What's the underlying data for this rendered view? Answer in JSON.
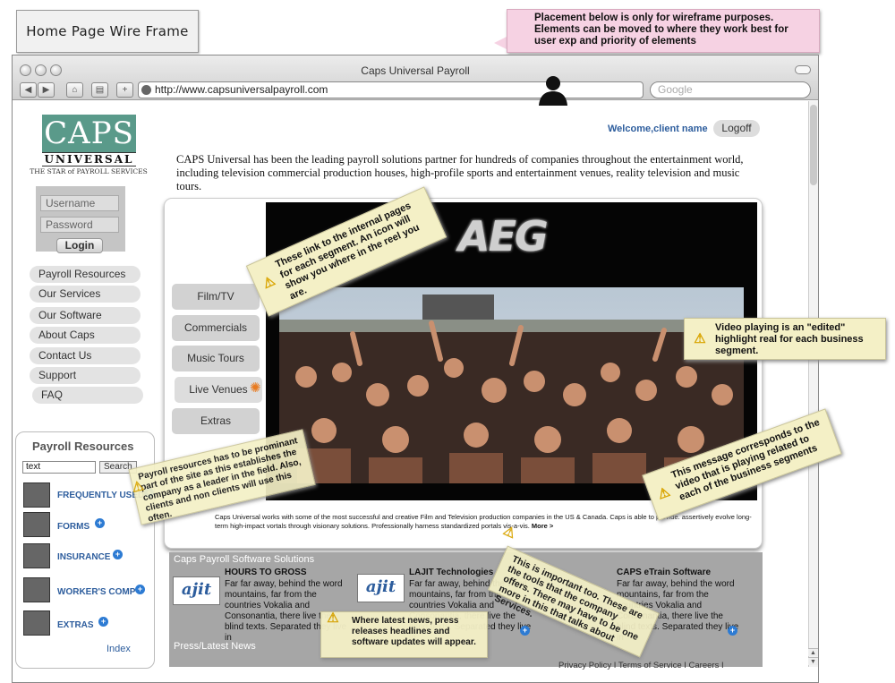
{
  "wireframe_title": "Home Page Wire Frame",
  "notes": {
    "placement": "Placement below is only for wireframe purposes. Elements can be moved to where they work best for user exp and priority of elements",
    "segments": "These link to the internal pages for each segment. An icon will show you where in the reel you are.",
    "video": "Video playing is an \"edited\" highlight real for each business segment.",
    "message": "This message corresponds to the video that is playing related to each of the business segments",
    "payroll": "Payroll resources has to be prominant part of the site as this establishes the company as a leader in the field. Also, clients and non clients will use this often.",
    "tools": "This is important too. These are the tools that the company offers. There may have to be one more in this that talks about Services.",
    "press": "Where latest news, press releases headlines and software updates will appear."
  },
  "browser": {
    "title": "Caps Universal Payroll",
    "url": "http://www.capsuniversalpayroll.com",
    "search_placeholder": "Google"
  },
  "logo": {
    "main": "CAPS",
    "band": "UNIVERSAL",
    "tagline": "THE STAR of PAYROLL SERVICES"
  },
  "login": {
    "username_placeholder": "Username",
    "password_placeholder": "Password",
    "button": "Login"
  },
  "sidebar": {
    "items": [
      {
        "label": "Payroll Resources"
      },
      {
        "label": "Our Services"
      },
      {
        "label": "Our Software"
      },
      {
        "label": "About Caps"
      },
      {
        "label": "Contact Us"
      },
      {
        "label": "Support"
      },
      {
        "label": "FAQ"
      }
    ]
  },
  "header": {
    "welcome": "Welcome,client name",
    "logoff": "Logoff"
  },
  "intro": "CAPS Universal has been the leading payroll solutions partner for hundreds of companies throughout the entertainment world, including television commercial production houses, high-profile sports and entertainment venues, reality television and music tours.",
  "video": {
    "brand": "AEG",
    "segments": [
      "Film/TV",
      "Commercials",
      "Music Tours",
      "Live Venues",
      "Extras"
    ],
    "caption": "Caps Universal works with some of the most successful and creative Film and Television production companies in the US & Canada.  Caps is able to provide. assertively evolve long-term high-impact vortals through visionary solutions. Professionally harness standardized portals vis-a-vis.",
    "more": "More >"
  },
  "software": {
    "heading": "Caps Payroll Software Solutions",
    "items": [
      {
        "title": "HOURS TO GROSS",
        "body": "Far far away, behind the word mountains, far from the countries Vokalia and Consonantia, there live the blind texts. Separated they live in"
      },
      {
        "title": "LAJIT Technologies",
        "body": "Far far away, behind the word mountains, far from the countries Vokalia and Consonantia, there live the blind texts. Separated they live in"
      },
      {
        "title": "CAPS eTrain Software",
        "body": "Far far away, behind the word mountains, far from the countries Vokalia and Consonantia, there live the blind texts. Separated they live in"
      }
    ],
    "icon_text": "ajit"
  },
  "press": {
    "heading": "Press/Latest News"
  },
  "footer": {
    "links": "Privacy Policy  I  Terms of Service  I     Careers  I"
  },
  "payroll_resources": {
    "title": "Payroll Resources",
    "search_value": "text",
    "search_button": "Search",
    "links": [
      "FREQUENTLY USED",
      "FORMS",
      "INSURANCE",
      "WORKER'S COMP",
      "EXTRAS"
    ],
    "index": "Index"
  },
  "colors": {
    "accent_blue": "#2d5d9d",
    "logo_teal": "#5a9a8a",
    "note_yellow": "#f4f0c6",
    "note_pink": "#f6d2e3"
  }
}
